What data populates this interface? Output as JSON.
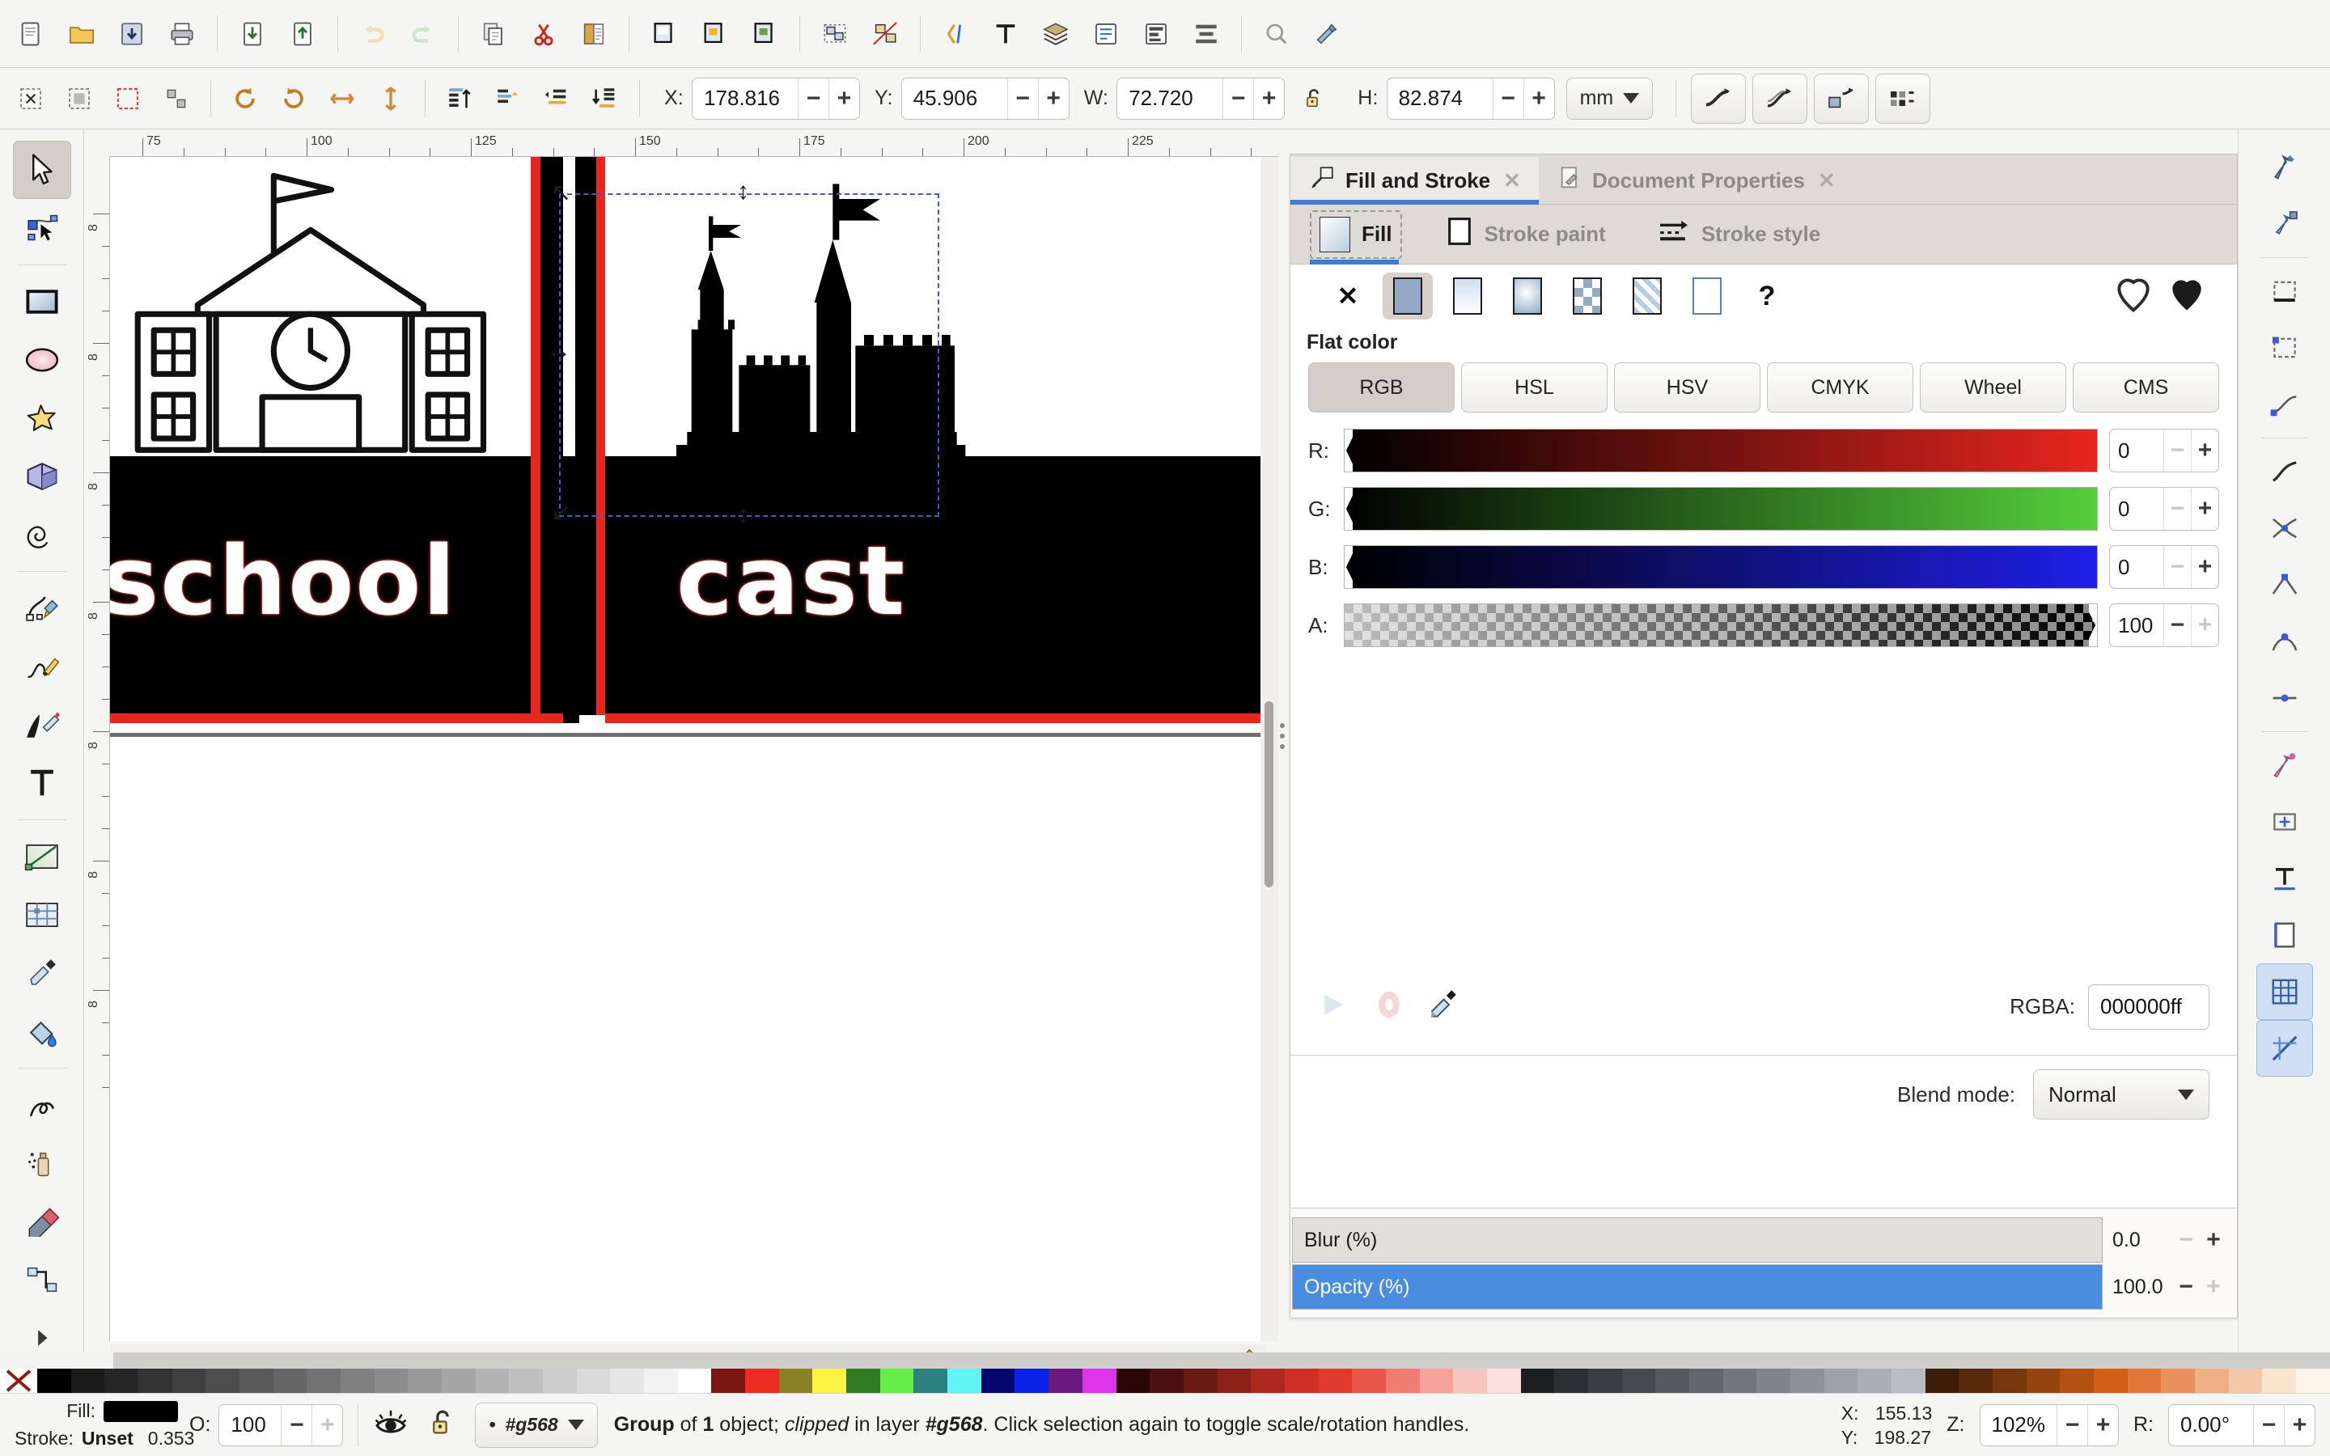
{
  "app": {
    "name": "Inkscape"
  },
  "command_toolbar": {
    "buttons": [
      {
        "name": "new-document-icon",
        "label": "New"
      },
      {
        "name": "open-document-icon",
        "label": "Open"
      },
      {
        "name": "save-document-icon",
        "label": "Save"
      },
      {
        "name": "print-document-icon",
        "label": "Print"
      },
      {
        "name": "import-icon",
        "label": "Import"
      },
      {
        "name": "export-icon",
        "label": "Export"
      },
      {
        "name": "undo-icon",
        "label": "Undo"
      },
      {
        "name": "redo-icon",
        "label": "Redo"
      },
      {
        "name": "copy-icon",
        "label": "Copy"
      },
      {
        "name": "cut-icon",
        "label": "Cut"
      },
      {
        "name": "paste-icon",
        "label": "Paste"
      },
      {
        "name": "duplicate-icon",
        "label": "Duplicate"
      },
      {
        "name": "clone-icon",
        "label": "Clone"
      },
      {
        "name": "unlink-clone-icon",
        "label": "Unlink Clone"
      },
      {
        "name": "group-icon",
        "label": "Group"
      },
      {
        "name": "ungroup-icon",
        "label": "Ungroup"
      },
      {
        "name": "xml-editor-icon",
        "label": "XML Editor"
      },
      {
        "name": "text-tool-icon",
        "label": "Text and Font"
      },
      {
        "name": "layers-icon",
        "label": "Layers"
      },
      {
        "name": "objects-icon",
        "label": "Objects"
      },
      {
        "name": "align-icon",
        "label": "Align and Distribute"
      },
      {
        "name": "zoom-icon",
        "label": "Zoom"
      },
      {
        "name": "preferences-icon",
        "label": "Preferences"
      }
    ]
  },
  "tool_options": {
    "select_buttons": [
      {
        "name": "select-all-icon",
        "label": "Select All"
      },
      {
        "name": "select-all-layers-icon",
        "label": "Select All in All Layers"
      },
      {
        "name": "deselect-icon",
        "label": "Deselect"
      },
      {
        "name": "select-same-icon",
        "label": "Select Same"
      },
      {
        "name": "rotate-ccw-icon",
        "label": "Rotate 90° CCW"
      },
      {
        "name": "rotate-cw-icon",
        "label": "Rotate 90° CW"
      },
      {
        "name": "flip-horizontal-icon",
        "label": "Flip Horizontal"
      },
      {
        "name": "flip-vertical-icon",
        "label": "Flip Vertical"
      },
      {
        "name": "raise-to-top-icon",
        "label": "Raise to Top"
      },
      {
        "name": "raise-icon",
        "label": "Raise"
      },
      {
        "name": "lower-icon",
        "label": "Lower"
      },
      {
        "name": "lower-to-bottom-icon",
        "label": "Lower to Bottom"
      }
    ],
    "x": {
      "label": "X:",
      "value": "178.816"
    },
    "y": {
      "label": "Y:",
      "value": "45.906"
    },
    "w": {
      "label": "W:",
      "value": "72.720"
    },
    "h": {
      "label": "H:",
      "value": "82.874"
    },
    "lock_ratio": "unlocked",
    "units": "mm",
    "transform_buttons": [
      {
        "name": "affect-stroke-width-icon",
        "label": "Scale stroke width"
      },
      {
        "name": "affect-rounded-corners-icon",
        "label": "Scale rounded corners"
      },
      {
        "name": "affect-gradients-icon",
        "label": "Move gradients"
      },
      {
        "name": "affect-patterns-icon",
        "label": "Move patterns"
      }
    ]
  },
  "toolbox": {
    "tools": [
      {
        "name": "selector-tool",
        "label": "Selector",
        "selected": true
      },
      {
        "name": "node-tool",
        "label": "Node editor",
        "selected": false
      },
      {
        "name": "rectangle-tool",
        "label": "Rectangle",
        "selected": false
      },
      {
        "name": "ellipse-tool",
        "label": "Ellipse/Arc",
        "selected": false
      },
      {
        "name": "star-tool",
        "label": "Star/Polygon",
        "selected": false
      },
      {
        "name": "box3d-tool",
        "label": "3D Box",
        "selected": false
      },
      {
        "name": "spiral-tool",
        "label": "Spiral",
        "selected": false
      },
      {
        "name": "bezier-tool",
        "label": "Bezier/Pen",
        "selected": false
      },
      {
        "name": "pencil-tool",
        "label": "Pencil",
        "selected": false
      },
      {
        "name": "calligraphy-tool",
        "label": "Calligraphy",
        "selected": false
      },
      {
        "name": "text-tool",
        "label": "Text",
        "selected": false
      },
      {
        "name": "gradient-tool",
        "label": "Gradient",
        "selected": false
      },
      {
        "name": "mesh-tool",
        "label": "Mesh Gradient",
        "selected": false
      },
      {
        "name": "dropper-tool",
        "label": "Color Picker",
        "selected": false
      },
      {
        "name": "paintbucket-tool",
        "label": "Paint Bucket",
        "selected": false
      },
      {
        "name": "tweak-tool",
        "label": "Tweak",
        "selected": false
      },
      {
        "name": "spray-tool",
        "label": "Spray",
        "selected": false
      },
      {
        "name": "eraser-tool",
        "label": "Eraser",
        "selected": false
      },
      {
        "name": "connector-tool",
        "label": "Connector",
        "selected": false
      },
      {
        "name": "more-tools",
        "label": "More tools",
        "selected": false
      }
    ]
  },
  "canvas": {
    "ruler_h_labels": [
      "75",
      "100",
      "125",
      "150",
      "175",
      "200",
      "225"
    ],
    "ruler_v_labels": [
      "8",
      "8",
      "8",
      "8",
      "8",
      "8",
      "8"
    ],
    "artwork": {
      "left_word": "school",
      "right_word": "cast",
      "left_caption_note": "schoolhouse line-art illustration",
      "right_caption_note": "castle silhouette illustration"
    },
    "selection": {
      "visible": true
    }
  },
  "dock": {
    "tabs": [
      {
        "name": "tab-fill-and-stroke",
        "label": "Fill and Stroke",
        "icon": "fill-stroke-icon",
        "active": true
      },
      {
        "name": "tab-document-properties",
        "label": "Document Properties",
        "icon": "document-properties-icon",
        "active": false
      }
    ],
    "subtabs": [
      {
        "name": "subtab-fill",
        "label": "Fill",
        "icon": "fill-swatch-icon",
        "active": true
      },
      {
        "name": "subtab-stroke-paint",
        "label": "Stroke paint",
        "icon": "stroke-paint-icon",
        "active": false
      },
      {
        "name": "subtab-stroke-style",
        "label": "Stroke style",
        "icon": "stroke-style-icon",
        "active": false
      }
    ],
    "paint_types": [
      {
        "name": "paint-none",
        "label": "No paint",
        "glyph": "✕",
        "selected": false
      },
      {
        "name": "paint-flat-color",
        "label": "Flat color",
        "selected": true
      },
      {
        "name": "paint-linear-gradient",
        "label": "Linear gradient",
        "selected": false
      },
      {
        "name": "paint-radial-gradient",
        "label": "Radial gradient",
        "selected": false
      },
      {
        "name": "paint-pattern",
        "label": "Pattern",
        "selected": false
      },
      {
        "name": "paint-swatch",
        "label": "Swatch",
        "selected": false
      },
      {
        "name": "paint-unknown",
        "label": "Unknown",
        "selected": false
      },
      {
        "name": "paint-help",
        "label": "?",
        "glyph": "?",
        "selected": false
      }
    ],
    "favorites": [
      {
        "name": "unset-paint-icon",
        "label": "Unset paint"
      },
      {
        "name": "set-paint-icon",
        "label": "Set paint"
      }
    ],
    "flat_color_label": "Flat color",
    "color_modes": [
      {
        "name": "color-mode-rgb",
        "label": "RGB",
        "selected": true
      },
      {
        "name": "color-mode-hsl",
        "label": "HSL",
        "selected": false
      },
      {
        "name": "color-mode-hsv",
        "label": "HSV",
        "selected": false
      },
      {
        "name": "color-mode-cmyk",
        "label": "CMYK",
        "selected": false
      },
      {
        "name": "color-mode-wheel",
        "label": "Wheel",
        "selected": false
      },
      {
        "name": "color-mode-cms",
        "label": "CMS",
        "selected": false
      }
    ],
    "channels": [
      {
        "name": "channel-red",
        "label": "R:",
        "value": "0",
        "max_color": "#e8251f",
        "pos_pct": 0,
        "alpha": false,
        "minus_dim": true,
        "plus_dim": false
      },
      {
        "name": "channel-green",
        "label": "G:",
        "value": "0",
        "max_color": "#55cf3b",
        "pos_pct": 0,
        "alpha": false,
        "minus_dim": true,
        "plus_dim": false
      },
      {
        "name": "channel-blue",
        "label": "B:",
        "value": "0",
        "max_color": "#1f1fe8",
        "pos_pct": 0,
        "alpha": false,
        "minus_dim": true,
        "plus_dim": false
      },
      {
        "name": "channel-alpha",
        "label": "A:",
        "value": "100",
        "max_color": "#000000",
        "pos_pct": 100,
        "alpha": true,
        "minus_dim": false,
        "plus_dim": true
      }
    ],
    "bottom_tools": [
      {
        "name": "color-wheel-icon",
        "label": "Pick color from wheel"
      },
      {
        "name": "color-managed-icon",
        "label": "Color managed"
      },
      {
        "name": "eyedropper-icon",
        "label": "Pick color from image"
      }
    ],
    "rgba": {
      "label": "RGBA:",
      "value": "000000ff"
    },
    "blend": {
      "label": "Blend mode:",
      "value": "Normal"
    },
    "effects": [
      {
        "name": "blur-slider",
        "label": "Blur (%)",
        "value": "0.0",
        "fill_pct": 0,
        "minus_dim": true,
        "plus_dim": false
      },
      {
        "name": "opacity-slider",
        "label": "Opacity (%)",
        "value": "100.0",
        "fill_pct": 100,
        "minus_dim": false,
        "plus_dim": true
      }
    ]
  },
  "snapbar": {
    "items": [
      {
        "name": "snap-enable-icon",
        "label": "Enable snapping",
        "on": false
      },
      {
        "name": "snap-bounding-box-icon",
        "label": "Snap bounding boxes",
        "on": false
      },
      {
        "name": "snap-bbox-edge-icon",
        "label": "Snap bounding box edges",
        "on": false
      },
      {
        "name": "snap-bbox-corner-icon",
        "label": "Snap bounding box corners",
        "on": false
      },
      {
        "name": "snap-nodes-icon",
        "label": "Snap nodes, paths, handles",
        "on": false
      },
      {
        "name": "snap-path-icon",
        "label": "Snap to paths",
        "on": false
      },
      {
        "name": "snap-path-intersection-icon",
        "label": "Snap to path intersections",
        "on": false
      },
      {
        "name": "snap-cusp-node-icon",
        "label": "Snap to cusp nodes",
        "on": false
      },
      {
        "name": "snap-smooth-node-icon",
        "label": "Snap to smooth nodes",
        "on": false
      },
      {
        "name": "snap-midpoint-icon",
        "label": "Snap to line midpoints",
        "on": false
      },
      {
        "name": "snap-others-icon",
        "label": "Snap other points",
        "on": false
      },
      {
        "name": "snap-object-center-icon",
        "label": "Snap to object centers",
        "on": false
      },
      {
        "name": "snap-text-baseline-icon",
        "label": "Snap text baselines",
        "on": false
      },
      {
        "name": "snap-page-border-icon",
        "label": "Snap to page border",
        "on": false
      },
      {
        "name": "snap-grid-icon",
        "label": "Snap to grids",
        "on": true
      },
      {
        "name": "snap-guide-icon",
        "label": "Snap to guides",
        "on": true
      }
    ]
  },
  "palette": {
    "none_swatch": "none-color-swatch",
    "colors": [
      "#000000",
      "#1a1a1a",
      "#262626",
      "#333333",
      "#404040",
      "#4d4d4d",
      "#595959",
      "#666666",
      "#737373",
      "#808080",
      "#8c8c8c",
      "#999999",
      "#a6a6a6",
      "#b3b3b3",
      "#bfbfbf",
      "#cccccc",
      "#d9d9d9",
      "#e6e6e6",
      "#f2f2f2",
      "#ffffff",
      "#7a1512",
      "#ec2b21",
      "#8a8024",
      "#fbf33f",
      "#2f7a23",
      "#64ec47",
      "#2c8181",
      "#62f3f3",
      "#04076f",
      "#0b22ea",
      "#6c1980",
      "#e033ec",
      "#2a0604",
      "#491210",
      "#6b1a14",
      "#8c2119",
      "#ad281f",
      "#cf3025",
      "#e03a2e",
      "#e8564a",
      "#ef7d72",
      "#f4a29a",
      "#f8c4be",
      "#fbe0dd",
      "#1e1f21",
      "#2c2e31",
      "#3a3c40",
      "#48494e",
      "#56585e",
      "#64666d",
      "#73757c",
      "#81838b",
      "#8f919a",
      "#9da0a8",
      "#abaeb7",
      "#b9bcc5",
      "#3a1c08",
      "#59290b",
      "#78360e",
      "#974310",
      "#b55013",
      "#d45e16",
      "#e3773a",
      "#e9925f",
      "#efae84",
      "#f4c9a9",
      "#f9e4ce",
      "#fdf4ea"
    ]
  },
  "statusbar": {
    "fill": {
      "label": "Fill:",
      "color": "#000000"
    },
    "stroke": {
      "label": "Stroke:",
      "value": "Unset"
    },
    "stroke_width": "0.353",
    "opacity": {
      "label": "O:",
      "value": "100"
    },
    "visibility_icon": "eye-icon",
    "lock_icon": "unlock-icon",
    "layer": {
      "name": "#g568",
      "indicator": "•"
    },
    "message_parts": [
      {
        "text": "Group",
        "style": "b"
      },
      {
        "text": " of ",
        "style": ""
      },
      {
        "text": "1",
        "style": "b"
      },
      {
        "text": " object; ",
        "style": ""
      },
      {
        "text": "clipped",
        "style": "i"
      },
      {
        "text": " in layer ",
        "style": ""
      },
      {
        "text": "#g568",
        "style": "bi"
      },
      {
        "text": ". Click selection again to toggle scale/rotation handles.",
        "style": ""
      }
    ],
    "message": "Group of 1 object; clipped in layer #g568. Click selection again to toggle scale/rotation handles.",
    "cursor_x": {
      "label": "X:",
      "value": "155.13"
    },
    "cursor_y": {
      "label": "Y:",
      "value": "198.27"
    },
    "zoom": {
      "label": "Z:",
      "value": "102%"
    },
    "rotation": {
      "label": "R:",
      "value": "0.00°"
    }
  },
  "colors": {
    "accent_blue": "#3b7ddd",
    "red_stripe": "#e8251f",
    "panel_bg": "#f5f5f3",
    "dock_tab_bg": "#dedbd6"
  }
}
